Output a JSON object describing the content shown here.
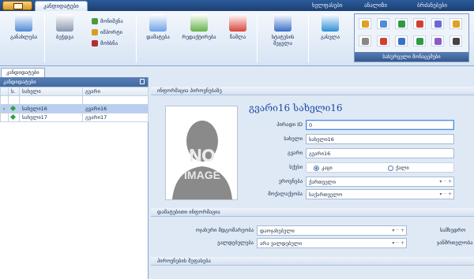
{
  "titlebar": {
    "active_tab": "კანდიდატები",
    "tabs": [
      "ხელფასები",
      "ანალიზი",
      "ბრძანებები"
    ]
  },
  "ribbon": {
    "buttons": [
      {
        "label": "განახლება",
        "icon": "refresh-icon",
        "color": "#4f8bd6"
      },
      {
        "label": "ბეჭდვა",
        "icon": "printer-icon",
        "color": "#8a98ad"
      },
      {
        "label": "დამატება",
        "icon": "add-document-icon",
        "color": "#6ea3e8"
      },
      {
        "label": "რედაქტირება",
        "icon": "edit-document-icon",
        "color": "#68b24b"
      },
      {
        "label": "წაშლა",
        "icon": "delete-document-icon",
        "color": "#d9463b"
      },
      {
        "label": "სტატუსის შეცვლა",
        "icon": "pen-icon",
        "color": "#3b6fc8"
      },
      {
        "label": "გასვლა",
        "icon": "exit-icon",
        "color": "#2f8fd8"
      }
    ],
    "small_buttons": [
      {
        "label": "მონიშვნა",
        "icon": "select-icon",
        "color": "#4a9a3e"
      },
      {
        "label": "იმპორტი",
        "icon": "import-icon",
        "color": "#d4a020"
      },
      {
        "label": "მოხსნა",
        "icon": "unselect-icon",
        "color": "#b03030"
      }
    ],
    "gallery_caption": "სასურველი მონაცემები",
    "gallery_colors": [
      "#e0a020",
      "#4f8bd6",
      "#2f9a45",
      "#d04030",
      "#6a6ad0",
      "#e0a020",
      "#888888",
      "#d04030",
      "#3b6fc8",
      "#2f9a45",
      "#8a5ac8",
      "#444444"
    ]
  },
  "left": {
    "doc_tab": "კანდიდატები",
    "panel_title": "კანდიდატები",
    "columns": [
      "ს.",
      "სახელი",
      "გვარი"
    ],
    "rows": [
      {
        "first": "სახელი16",
        "last": "გვარი16",
        "selected": true
      },
      {
        "first": "სახელი17",
        "last": "გვარი17",
        "selected": false
      }
    ]
  },
  "personal": {
    "section_title": "ინფორმაცია პიროვნებაზე",
    "full_name": "გვარი16 სახელი16",
    "id_label": "პირადი ID",
    "id_value": "0",
    "first_label": "სახელი",
    "first_value": "სახელი16",
    "last_label": "გვარი",
    "last_value": "გვარი16",
    "gender_label": "სქესი",
    "gender_options": [
      "კაცი",
      "ქალი"
    ],
    "gender_selected": 0,
    "nationality_label": "ეროვნება",
    "nationality_value": "ქართველი",
    "citizenship_label": "მოქალაქეობა",
    "citizenship_value": "საქართველო",
    "photo_text_top": "NO",
    "photo_text_bottom": "IMAGE"
  },
  "extra": {
    "section_title": "დამატებითი ინფორმაცია",
    "family_label": "ოჯახური მდგომარეობა",
    "family_value": "დაოჯახებული",
    "military_label": "სამხედრო",
    "duty_label": "ვალდებულება",
    "duty_value": "არა ვალდებული",
    "health_label": "ჯანმრთელობა",
    "skills_title": "პიროვნების შეფასება"
  }
}
